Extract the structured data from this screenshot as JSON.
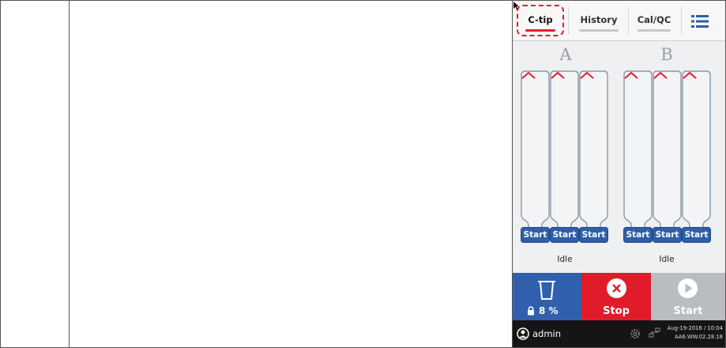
{
  "tabs": [
    {
      "label": "C-tip",
      "active": true
    },
    {
      "label": "History",
      "active": false
    },
    {
      "label": "Cal/QC",
      "active": false
    }
  ],
  "menu_icon": "list-menu-icon",
  "groups": [
    {
      "letter": "A",
      "status": "Idle",
      "channels": [
        {
          "button": "Start",
          "icon": "chevron-up-icon"
        },
        {
          "button": "Start",
          "icon": "chevron-up-icon"
        },
        {
          "button": "Start",
          "icon": "chevron-up-icon"
        }
      ]
    },
    {
      "letter": "B",
      "status": "Idle",
      "channels": [
        {
          "button": "Start",
          "icon": "chevron-up-icon"
        },
        {
          "button": "Start",
          "icon": "chevron-up-icon"
        },
        {
          "button": "Start",
          "icon": "chevron-up-icon"
        }
      ]
    }
  ],
  "actions": {
    "waste_level": "8 %",
    "stop_label": "Stop",
    "start_label": "Start"
  },
  "footer": {
    "user": "admin",
    "datetime": "Aug-19-2016 / 10:04",
    "version": "AA6.WW.02.28.18"
  },
  "colors": {
    "accent_red": "#e11b2a",
    "primary_blue": "#3060ad",
    "disabled_gray": "#b9bcc1",
    "footer_bg": "#151515"
  }
}
